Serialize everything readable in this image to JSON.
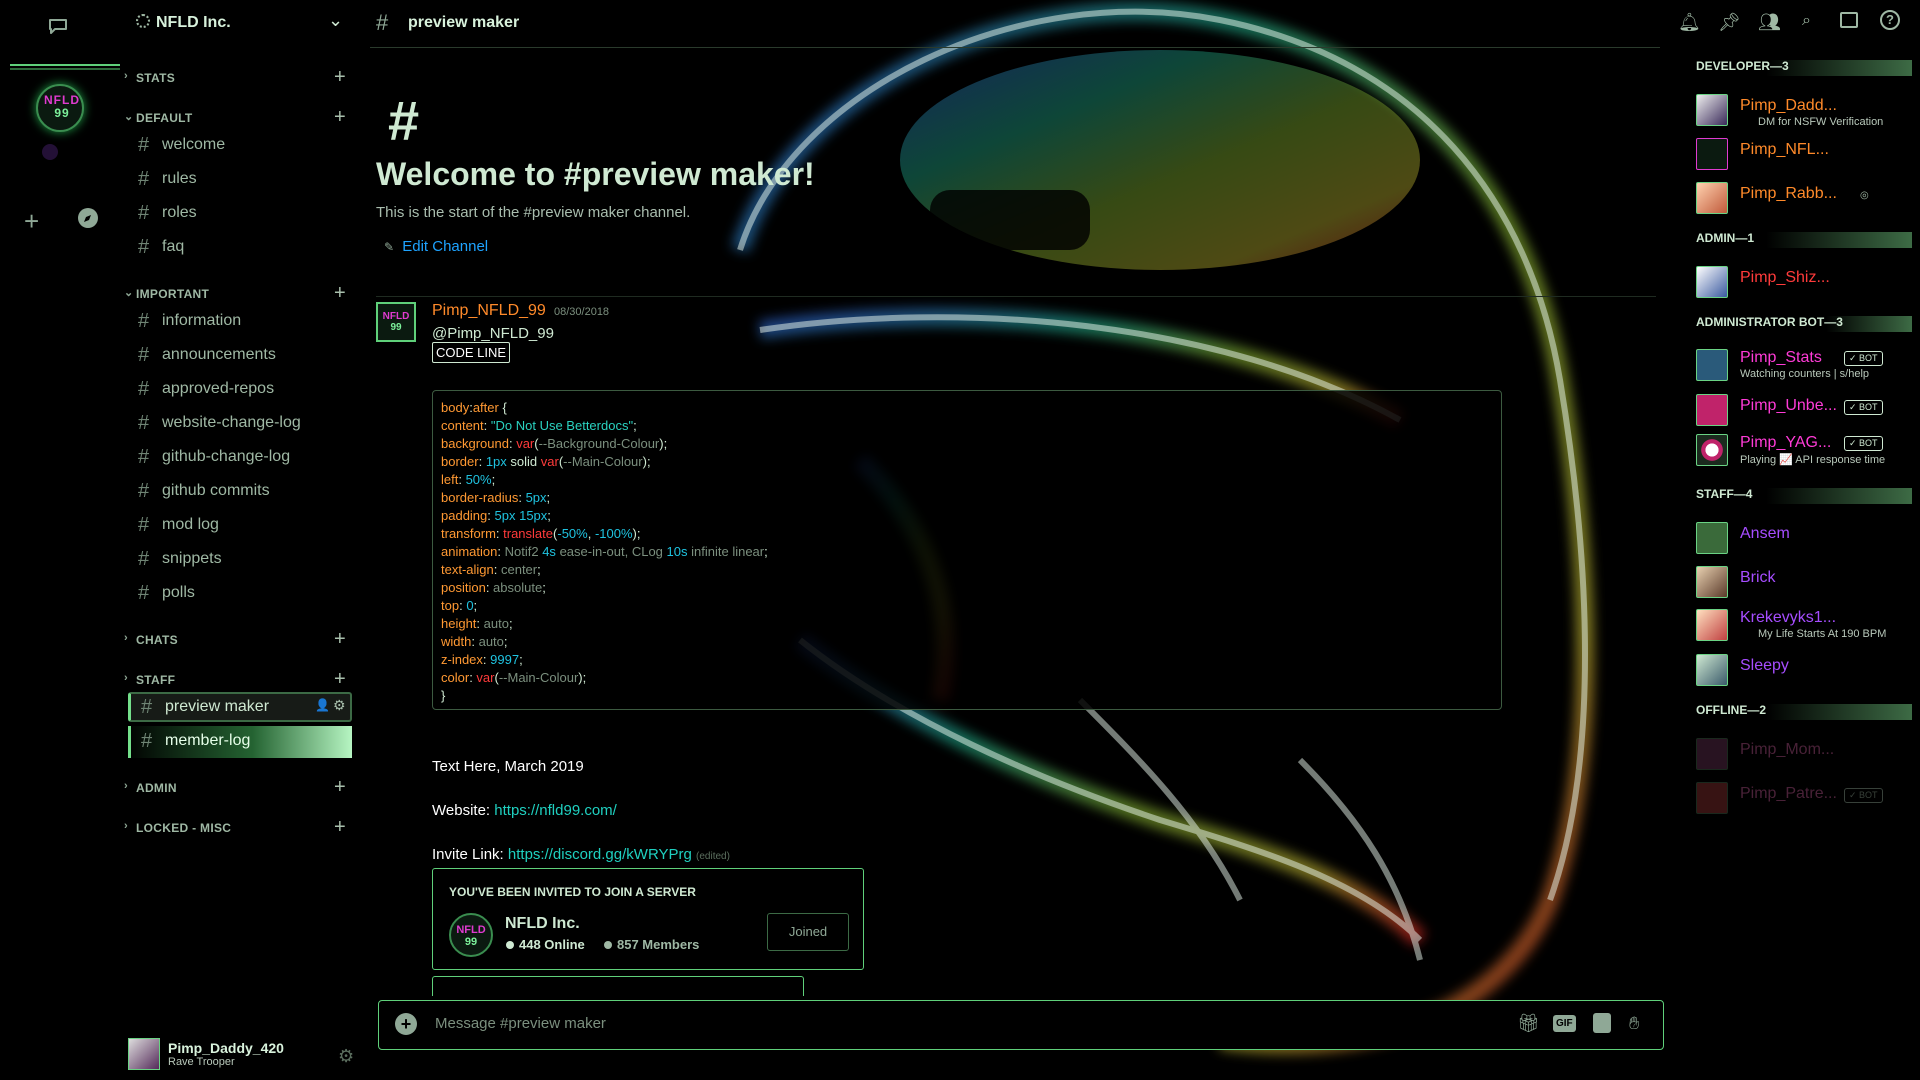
{
  "server": {
    "name": "NFLD Inc.",
    "icon_text": "NFLD\n99"
  },
  "channel": {
    "name": "preview maker"
  },
  "categories": [
    {
      "label": "STATS"
    },
    {
      "label": "DEFAULT"
    },
    {
      "label": "IMPORTANT"
    },
    {
      "label": "CHATS"
    },
    {
      "label": "STAFF"
    },
    {
      "label": "ADMIN"
    },
    {
      "label": "LOCKED - MISC"
    }
  ],
  "channels_default": [
    "welcome",
    "rules",
    "roles",
    "faq"
  ],
  "channels_important": [
    "information",
    "announcements",
    "approved-repos",
    "website-change-log",
    "github-change-log",
    "github commits",
    "mod log",
    "snippets",
    "polls"
  ],
  "channels_staff": [
    "preview maker",
    "member-log"
  ],
  "welcome": {
    "title": "Welcome to #preview maker!",
    "subtitle": "This is the start of the #preview maker channel.",
    "edit": "Edit Channel"
  },
  "message": {
    "author": "Pimp_NFLD_99",
    "timestamp": "08/30/2018",
    "mention": "@Pimp_NFLD_99",
    "code_label": "CODE LINE",
    "code_lines": [
      "body:after {",
      "content: \"Do Not Use Betterdocs\";",
      "background: var(--Background-Colour);",
      "border: 1px solid var(--Main-Colour);",
      "left: 50%;",
      "border-radius: 5px;",
      "padding: 5px 15px;",
      "transform: translate(-50%, -100%);",
      "animation: Notif2 4s ease-in-out, CLog 10s infinite linear;",
      "text-align: center;",
      "position: absolute;",
      "top: 0;",
      "height: auto;",
      "width: auto;",
      "z-index: 9997;",
      "color: var(--Main-Colour);",
      "}"
    ],
    "text_line": "Text Here, March 2019",
    "website_label": "Website:",
    "website_url": "https://nfld99.com/",
    "invite_label": "Invite Link:",
    "invite_url": "https://discord.gg/kWRYPrg",
    "invite_edited": "(edited)"
  },
  "invite_card": {
    "heading": "YOU'VE BEEN INVITED TO JOIN A SERVER",
    "server_name": "NFLD Inc.",
    "online": "448 Online",
    "members": "857 Members",
    "button": "Joined"
  },
  "composer": {
    "placeholder": "Message #preview maker"
  },
  "user": {
    "name": "Pimp_Daddy_420",
    "status": "Rave Trooper"
  },
  "member_groups": [
    {
      "label": "DEVELOPER—3",
      "members": [
        {
          "name": "Pimp_Dadd...",
          "status": "DM for NSFW Verification",
          "color": "#ff8a2a"
        },
        {
          "name": "Pimp_NFL...",
          "status": "",
          "color": "#ff8a2a"
        },
        {
          "name": "Pimp_Rabb...",
          "status": "",
          "color": "#ff8a2a"
        }
      ]
    },
    {
      "label": "ADMIN—1",
      "members": [
        {
          "name": "Pimp_Shiz...",
          "status": "",
          "color": "#ff3b3b"
        }
      ]
    },
    {
      "label": "ADMINISTRATOR BOT—3",
      "members": [
        {
          "name": "Pimp_Stats",
          "status": "Watching counters | s/help",
          "color": "#ff3bd7",
          "badge": "✓ BOT"
        },
        {
          "name": "Pimp_Unbe...",
          "status": "",
          "color": "#ff3bd7",
          "badge": "✓ BOT"
        },
        {
          "name": "Pimp_YAG...",
          "status": "Playing 📈 API response time",
          "color": "#ff3bd7",
          "badge": "✓ BOT"
        }
      ]
    },
    {
      "label": "STAFF—4",
      "members": [
        {
          "name": "Ansem",
          "status": "",
          "color": "#a64dff"
        },
        {
          "name": "Brick",
          "status": "",
          "color": "#a64dff"
        },
        {
          "name": "Krekevyks1...",
          "status": "My Life Starts At 190 BPM",
          "color": "#a64dff"
        },
        {
          "name": "Sleepy",
          "status": "",
          "color": "#a64dff"
        }
      ]
    },
    {
      "label": "OFFLINE—2",
      "members": [
        {
          "name": "Pimp_Mom...",
          "status": "",
          "color": "#5a2a4a"
        },
        {
          "name": "Pimp_Patre...",
          "status": "",
          "color": "#5a2a4a",
          "badge": "✓ BOT"
        }
      ]
    }
  ]
}
